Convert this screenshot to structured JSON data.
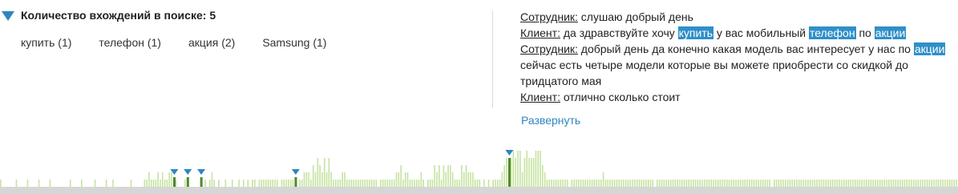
{
  "summary": {
    "title": "Количество вхождений в поиске:",
    "count": "5",
    "keywords": [
      "купить (1)",
      "телефон (1)",
      "акция (2)",
      "Samsung (1)"
    ]
  },
  "transcript": {
    "lines": [
      {
        "speaker": "Сотрудник:",
        "parts": [
          {
            "t": " слушаю добрый день",
            "h": false
          }
        ]
      },
      {
        "speaker": "Клиент:",
        "parts": [
          {
            "t": " да здравствуйте хочу ",
            "h": false
          },
          {
            "t": "купить",
            "h": true
          },
          {
            "t": " у вас мобильный ",
            "h": false
          },
          {
            "t": "телефон",
            "h": true
          },
          {
            "t": " по ",
            "h": false
          },
          {
            "t": "акции",
            "h": true
          }
        ]
      },
      {
        "speaker": "Сотрудник:",
        "parts": [
          {
            "t": " добрый день да конечно какая модель вас интересует у нас по ",
            "h": false
          },
          {
            "t": "акции",
            "h": true
          },
          {
            "t": " сейчас есть четыре модели которые вы можете приобрести со скидкой до тридцатого мая",
            "h": false
          }
        ]
      },
      {
        "speaker": "Клиент:",
        "parts": [
          {
            "t": " отлично сколько стоит",
            "h": false
          }
        ]
      }
    ],
    "expand_label": "Развернуть"
  },
  "colors": {
    "accent": "#2e86c1",
    "highlight": "#2f8fc8",
    "bar": "#c5e3a1",
    "bar_match": "#4f8a2b",
    "baseline": "#d6d6d6"
  },
  "timeline": {
    "bars": [
      1,
      0,
      0,
      0,
      0,
      0,
      0,
      1,
      0,
      0,
      0,
      0,
      1,
      0,
      0,
      0,
      0,
      1,
      0,
      0,
      0,
      0,
      1,
      0,
      0,
      0,
      0,
      0,
      0,
      0,
      0,
      1,
      0,
      0,
      0,
      0,
      1,
      0,
      0,
      0,
      0,
      0,
      1,
      0,
      0,
      0,
      0,
      1,
      0,
      0,
      1,
      0,
      0,
      0,
      0,
      0,
      0,
      0,
      1,
      0,
      0,
      0,
      0,
      0,
      1,
      1,
      2,
      1,
      1,
      1,
      2,
      1,
      2,
      1,
      1,
      2,
      2,
      0,
      1,
      0,
      0,
      0,
      1,
      0,
      0,
      0,
      0,
      0,
      0,
      1,
      0,
      1,
      0,
      1,
      2,
      1,
      0,
      1,
      0,
      0,
      1,
      0,
      0,
      1,
      0,
      0,
      1,
      0,
      1,
      0,
      1,
      0,
      1,
      1,
      0,
      1,
      1,
      1,
      1,
      1,
      1,
      1,
      1,
      1,
      0,
      1,
      1,
      1,
      1,
      1,
      1,
      1,
      0,
      1,
      1,
      2,
      2,
      2,
      1,
      3,
      2,
      4,
      3,
      2,
      4,
      2,
      4,
      2,
      1,
      1,
      1,
      1,
      2,
      2,
      1,
      1,
      1,
      1,
      1,
      1,
      1,
      1,
      1,
      1,
      1,
      1,
      1,
      1,
      0,
      1,
      1,
      1,
      1,
      1,
      1,
      1,
      2,
      2,
      3,
      1,
      2,
      2,
      1,
      1,
      1,
      1,
      1,
      2,
      1,
      0,
      1,
      1,
      1,
      3,
      2,
      3,
      1,
      3,
      2,
      3,
      3,
      2,
      1,
      1,
      1,
      3,
      2,
      3,
      2,
      2,
      2,
      1,
      1,
      1,
      0,
      1,
      0,
      1,
      0,
      1,
      1,
      1,
      1,
      2,
      3,
      4,
      4,
      4,
      5,
      4,
      5,
      5,
      2,
      4,
      5,
      4,
      4,
      4,
      5,
      5,
      5,
      3,
      2,
      1,
      1,
      1,
      1,
      1,
      1,
      1,
      1,
      1,
      1,
      0,
      1,
      1,
      1,
      1,
      1,
      1,
      1,
      1,
      1,
      1,
      1,
      1,
      1,
      1,
      2,
      1,
      1,
      1,
      1,
      1,
      1,
      1,
      1,
      1,
      1,
      1,
      1,
      1,
      1,
      1,
      1,
      1,
      1,
      1,
      1,
      1,
      1,
      0,
      1,
      1,
      1,
      1,
      1,
      1,
      1,
      1,
      1,
      1,
      1,
      1,
      1,
      1,
      1,
      1,
      1,
      1,
      1,
      1,
      1,
      1,
      1,
      1,
      1,
      1,
      1,
      1,
      1,
      1,
      1,
      1,
      1,
      1,
      1,
      1,
      1,
      1,
      1,
      1,
      1,
      1,
      1,
      1,
      1,
      1,
      1,
      1,
      1,
      1,
      1,
      0,
      1,
      1,
      1,
      1,
      1,
      1,
      1,
      1,
      1,
      1,
      1,
      1,
      1,
      1,
      1,
      1,
      1,
      1,
      1,
      1,
      1,
      1,
      1,
      1,
      1,
      1,
      1,
      1,
      1,
      1,
      1,
      1,
      1,
      1,
      1,
      1,
      1,
      1,
      1,
      1,
      1,
      1,
      1,
      1,
      1,
      1,
      1,
      1,
      1,
      1,
      1,
      1,
      1,
      1,
      1,
      1,
      1,
      1,
      1,
      1,
      1,
      1,
      1,
      1,
      1,
      1,
      1,
      1,
      1,
      1,
      1,
      1,
      1,
      1,
      1,
      1,
      1,
      1,
      1,
      1,
      1,
      1
    ],
    "matches": [
      0.18,
      0.196,
      0.208,
      0.308,
      0.531
    ]
  }
}
